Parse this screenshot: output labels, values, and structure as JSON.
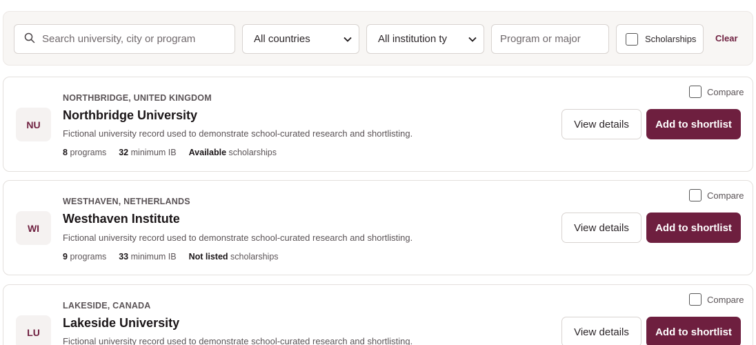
{
  "filters": {
    "search_placeholder": "Search university, city or program",
    "country_select": "All countries",
    "institution_select": "All institution ty",
    "program_placeholder": "Program or major",
    "scholarships_label": "Scholarships",
    "clear_label": "Clear"
  },
  "cards": [
    {
      "initials": "NU",
      "location": "NORTHBRIDGE, UNITED KINGDOM",
      "name": "Northbridge University",
      "description": "Fictional university record used to demonstrate school-curated research and shortlisting.",
      "programs_count": "8",
      "programs_label": "programs",
      "min_ib": "32",
      "min_ib_label": "minimum IB",
      "scholarship_status": "Available",
      "scholarship_label": "scholarships",
      "compare_label": "Compare",
      "view_label": "View details",
      "shortlist_label": "Add to shortlist"
    },
    {
      "initials": "WI",
      "location": "WESTHAVEN, NETHERLANDS",
      "name": "Westhaven Institute",
      "description": "Fictional university record used to demonstrate school-curated research and shortlisting.",
      "programs_count": "9",
      "programs_label": "programs",
      "min_ib": "33",
      "min_ib_label": "minimum IB",
      "scholarship_status": "Not listed",
      "scholarship_label": "scholarships",
      "compare_label": "Compare",
      "view_label": "View details",
      "shortlist_label": "Add to shortlist"
    },
    {
      "initials": "LU",
      "location": "LAKESIDE, CANADA",
      "name": "Lakeside University",
      "description": "Fictional university record used to demonstrate school-curated research and shortlisting.",
      "compare_label": "Compare",
      "view_label": "View details",
      "shortlist_label": "Add to shortlist"
    }
  ],
  "colors": {
    "accent": "#6e1f3f",
    "filter_background": "#f8f6f4"
  }
}
